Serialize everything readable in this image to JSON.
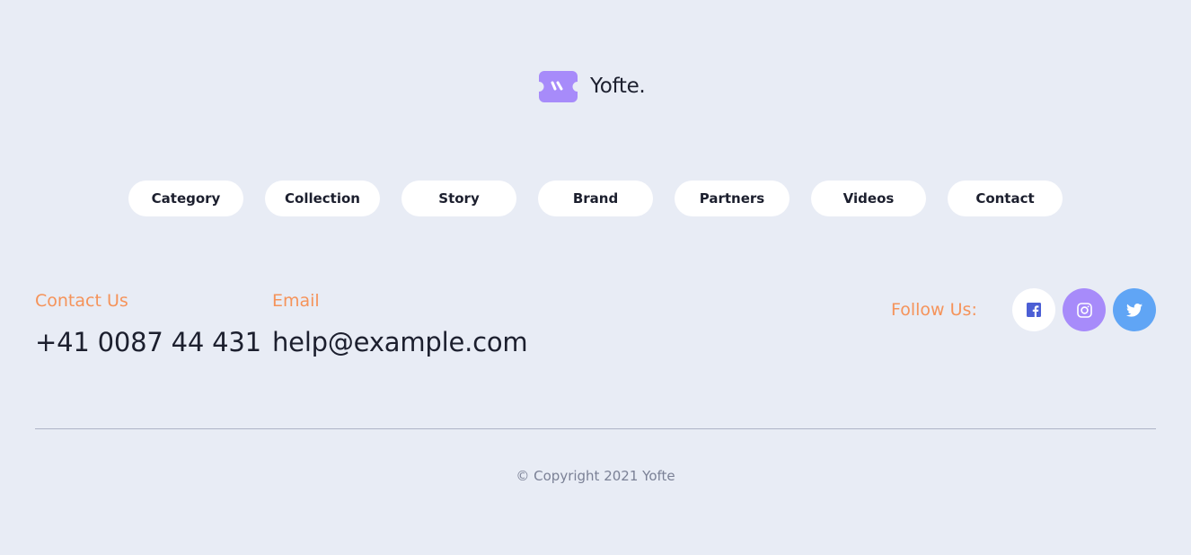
{
  "brand": {
    "name": "Yofte.",
    "logo_icon": "yofte-logo-icon",
    "accent_color": "#a78bfa"
  },
  "nav": {
    "items": [
      {
        "label": "Category"
      },
      {
        "label": "Collection"
      },
      {
        "label": "Story"
      },
      {
        "label": "Brand"
      },
      {
        "label": "Partners"
      },
      {
        "label": "Videos"
      },
      {
        "label": "Contact"
      }
    ]
  },
  "contact": {
    "phone_label": "Contact Us",
    "phone_value": "+41 0087 44 431",
    "email_label": "Email",
    "email_value": "help@example.com"
  },
  "social": {
    "label": "Follow Us:",
    "items": [
      {
        "icon": "facebook-icon",
        "color": "#ffffff"
      },
      {
        "icon": "instagram-icon",
        "color": "#a78bfa"
      },
      {
        "icon": "twitter-icon",
        "color": "#60a5f5"
      }
    ]
  },
  "footer": {
    "copyright": "© Copyright 2021 Yofte"
  },
  "colors": {
    "background": "#e8ecf5",
    "label_accent": "#f5935a",
    "text_dark": "#1c1f2e",
    "text_muted": "#7b8196"
  }
}
